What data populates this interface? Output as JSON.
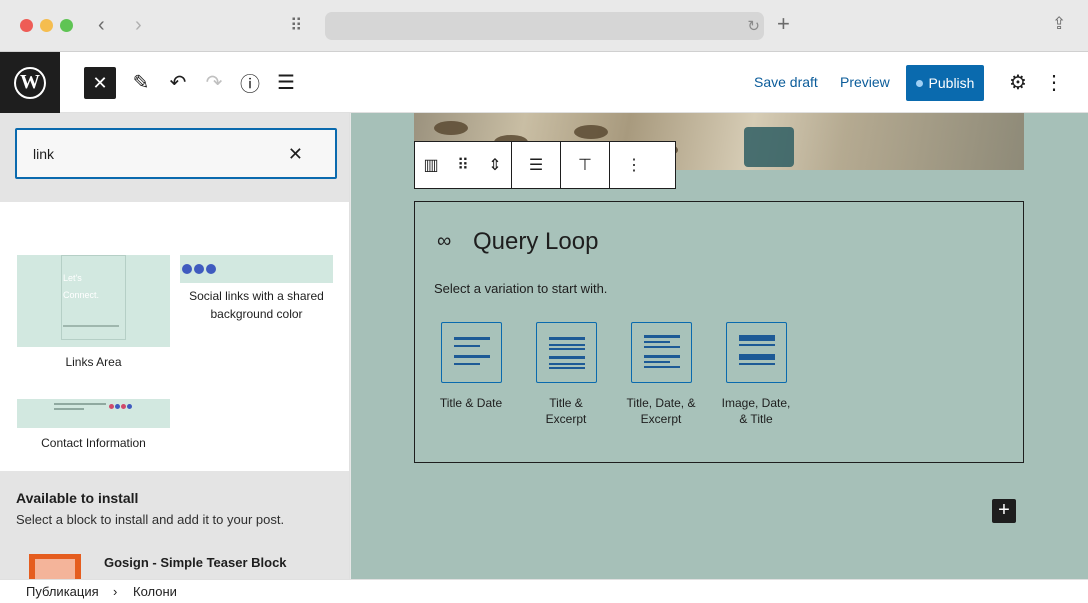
{
  "browser": {
    "url": "",
    "back_icon": "chevron-left-icon",
    "forward_icon": "chevron-right-icon",
    "grid_icon": "grid-icon",
    "new_tab_icon": "plus-icon",
    "share_icon": "share-icon"
  },
  "toolbar": {
    "close_icon": "close-icon",
    "tools_icon": "pencil-icon",
    "undo_icon": "undo-icon",
    "redo_icon": "redo-icon",
    "info_icon": "info-icon",
    "list_view_icon": "list-view-icon",
    "save_draft": "Save draft",
    "preview": "Preview",
    "publish": "Publish",
    "settings_icon": "gear-icon",
    "options_icon": "more-vertical-icon"
  },
  "inserter": {
    "search_value": "link",
    "patterns": [
      {
        "label": "Links Area",
        "thumb_text_1": "Let's",
        "thumb_text_2": "Connect."
      },
      {
        "label": "Social links with a shared background color"
      },
      {
        "label": "Contact Information"
      }
    ],
    "available_title": "Available to install",
    "available_desc": "Select a block to install and add it to your post.",
    "plugin_name": "Gosign - Simple Teaser Block"
  },
  "canvas": {
    "query_title": "Query Loop",
    "query_desc": "Select a variation to start with.",
    "variations": [
      {
        "line1": "Title & Date",
        "line2": ""
      },
      {
        "line1": "Title &",
        "line2": "Excerpt"
      },
      {
        "line1": "Title, Date, &",
        "line2": "Excerpt"
      },
      {
        "line1": "Image, Date,",
        "line2": "& Title"
      }
    ]
  },
  "breadcrumb": {
    "items": [
      "Публикация",
      "Колони"
    ],
    "separator": "›"
  },
  "colors": {
    "accent": "#0a6aae",
    "canvas_bg": "#a6c0b8",
    "pattern_bg": "#d2e8e0"
  }
}
